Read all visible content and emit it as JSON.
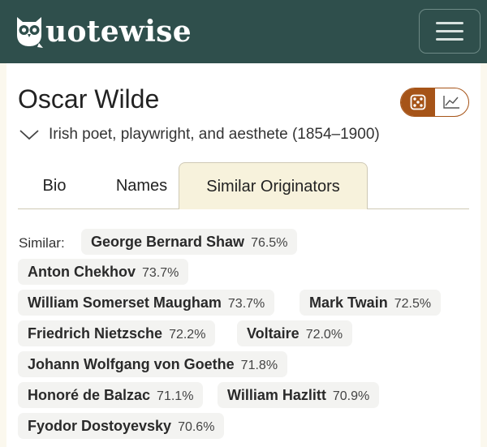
{
  "brand": {
    "logo_text": "Quotewise",
    "text": "uotewise"
  },
  "page": {
    "title": "Oscar Wilde",
    "description": "Irish poet, playwright, and aesthete (1854–1900)"
  },
  "tabs": [
    {
      "label": "Bio",
      "active": false
    },
    {
      "label": "Names",
      "active": false
    },
    {
      "label": "Similar Originators",
      "active": true
    }
  ],
  "similar": {
    "label": "Similar:",
    "items": [
      {
        "name": "George Bernard Shaw",
        "score": "76.5%"
      },
      {
        "name": "Anton Chekhov",
        "score": "73.7%"
      },
      {
        "name": "William Somerset Maugham",
        "score": "73.7%"
      },
      {
        "name": "Mark Twain",
        "score": "72.5%"
      },
      {
        "name": "Friedrich Nietzsche",
        "score": "72.2%"
      },
      {
        "name": "Voltaire",
        "score": "72.0%"
      },
      {
        "name": "Johann Wolfgang von Goethe",
        "score": "71.8%"
      },
      {
        "name": "Honoré de Balzac",
        "score": "71.1%"
      },
      {
        "name": "William Hazlitt",
        "score": "70.9%"
      },
      {
        "name": "Fyodor Dostoyevsky",
        "score": "70.6%"
      }
    ]
  },
  "colors": {
    "navbar": "#2f4f4c",
    "accent": "#a65418",
    "page_bg": "#fbf8ee"
  },
  "icons": [
    "owl-logo-icon",
    "hamburger-menu-icon",
    "dice-icon",
    "line-chart-icon",
    "chevron-down-icon"
  ]
}
